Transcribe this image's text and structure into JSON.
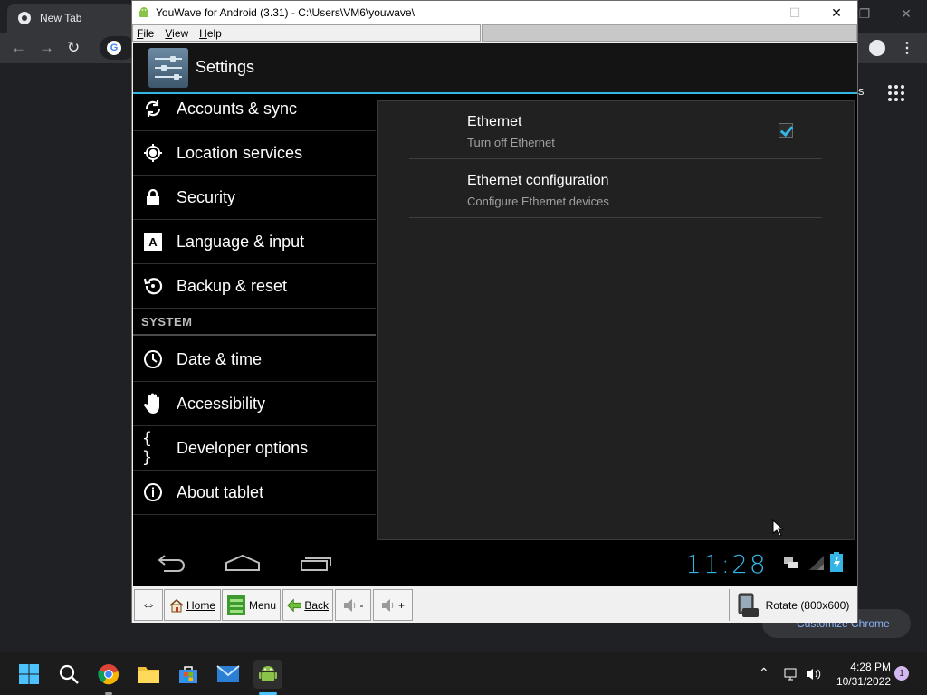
{
  "chrome": {
    "tab_title": "New Tab",
    "partial_link_text": "s",
    "customize_label": "Customize Chrome"
  },
  "window": {
    "title": "YouWave for Android (3.31) - C:\\Users\\VM6\\youwave\\",
    "menus": [
      "File",
      "View",
      "Help"
    ]
  },
  "android": {
    "action_bar_title": "Settings",
    "left_items_top": [
      {
        "label": "Accounts & sync",
        "icon": "sync-icon"
      },
      {
        "label": "Location services",
        "icon": "location-icon"
      },
      {
        "label": "Security",
        "icon": "lock-icon"
      },
      {
        "label": "Language & input",
        "icon": "keyboard-a-icon"
      },
      {
        "label": "Backup & reset",
        "icon": "backup-icon"
      }
    ],
    "section_system": "SYSTEM",
    "left_items_system": [
      {
        "label": "Date & time",
        "icon": "clock-icon"
      },
      {
        "label": "Accessibility",
        "icon": "hand-icon"
      },
      {
        "label": "Developer options",
        "icon": "braces-icon"
      },
      {
        "label": "About tablet",
        "icon": "info-icon"
      }
    ],
    "prefs": [
      {
        "title": "Ethernet",
        "summary": "Turn off Ethernet",
        "checked": true
      },
      {
        "title": "Ethernet configuration",
        "summary": "Configure Ethernet devices"
      }
    ],
    "clock": "11:28",
    "accent": "#33b5e5"
  },
  "toolbar": {
    "home": "Home",
    "menu": "Menu",
    "back": "Back",
    "vol_down": "-",
    "vol_up": "+",
    "rotate": "Rotate (800x600)"
  },
  "taskbar": {
    "time": "4:28 PM",
    "date": "10/31/2022",
    "notification_count": "1"
  }
}
